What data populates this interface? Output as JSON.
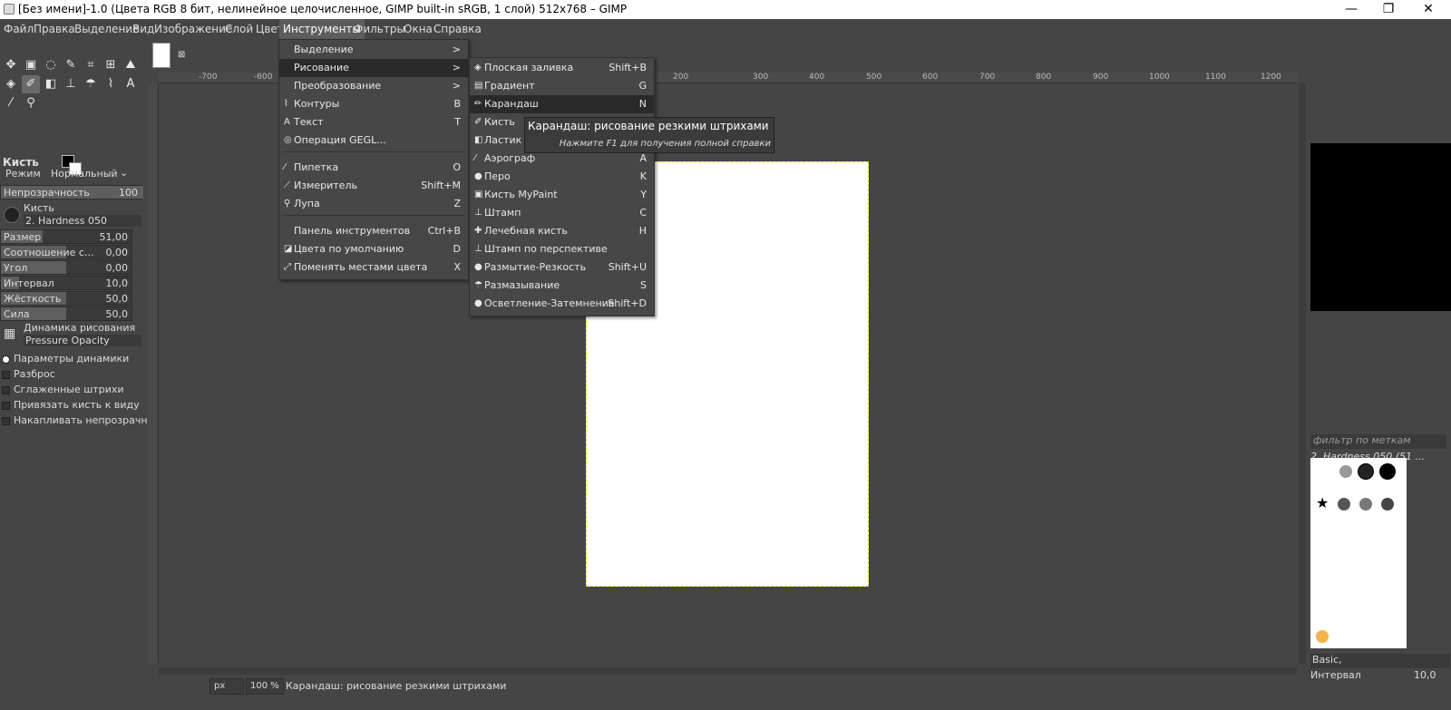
{
  "window": {
    "title": "[Без имени]-1.0 (Цвета RGB 8 бит, нелинейное целочисленное, GIMP built-in sRGB, 1 слой) 512x768 – GIMP",
    "minimize": "—",
    "maximize": "❐",
    "close": "✕"
  },
  "menubar": [
    "Файл",
    "Правка",
    "Выделение",
    "Вид",
    "Изображение",
    "Слой",
    "Цвет",
    "Инструменты",
    "Фильтры",
    "Окна",
    "Справка"
  ],
  "tools_menu": {
    "items": [
      {
        "label": "Выделение",
        "shortcut": "",
        "submenu": ">"
      },
      {
        "label": "Рисование",
        "shortcut": "",
        "submenu": ">"
      },
      {
        "label": "Преобразование",
        "shortcut": "",
        "submenu": ">"
      },
      {
        "label": "Контуры",
        "shortcut": "B"
      },
      {
        "label": "Текст",
        "shortcut": "T"
      },
      {
        "label": "Операция GEGL...",
        "shortcut": ""
      },
      {
        "label": "Пипетка",
        "shortcut": "O"
      },
      {
        "label": "Измеритель",
        "shortcut": "Shift+M"
      },
      {
        "label": "Лупа",
        "shortcut": "Z"
      },
      {
        "label": "Панель инструментов",
        "shortcut": "Ctrl+B"
      },
      {
        "label": "Цвета по умолчанию",
        "shortcut": "D"
      },
      {
        "label": "Поменять местами цвета",
        "shortcut": "X"
      }
    ]
  },
  "paint_submenu": {
    "items": [
      {
        "label": "Плоская заливка",
        "shortcut": "Shift+B"
      },
      {
        "label": "Градиент",
        "shortcut": "G"
      },
      {
        "label": "Карандаш",
        "shortcut": "N"
      },
      {
        "label": "Кисть",
        "shortcut": ""
      },
      {
        "label": "Ластик",
        "shortcut": ""
      },
      {
        "label": "Аэрограф",
        "shortcut": "A"
      },
      {
        "label": "Перо",
        "shortcut": "K"
      },
      {
        "label": "Кисть MyPaint",
        "shortcut": "Y"
      },
      {
        "label": "Штамп",
        "shortcut": "C"
      },
      {
        "label": "Лечебная кисть",
        "shortcut": "H"
      },
      {
        "label": "Штамп по перспективе",
        "shortcut": ""
      },
      {
        "label": "Размытие-Резкость",
        "shortcut": "Shift+U"
      },
      {
        "label": "Размазывание",
        "shortcut": "S"
      },
      {
        "label": "Осветление-Затемнение",
        "shortcut": "Shift+D"
      }
    ]
  },
  "tooltip": {
    "title": "Карандаш: рисование резкими штрихами",
    "hint": "Нажмите F1 для получения полной справки"
  },
  "tool_options": {
    "title": "Кисть",
    "mode_label": "Режим",
    "mode_value": "Нормальный",
    "opacity_label": "Непрозрачность",
    "opacity_value": "100",
    "brush_label": "Кисть",
    "brush_value": "2. Hardness 050",
    "sliders": [
      {
        "label": "Размер",
        "value": "51,00"
      },
      {
        "label": "Соотношение с...",
        "value": "0,00"
      },
      {
        "label": "Угол",
        "value": "0,00"
      },
      {
        "label": "Интервал",
        "value": "10,0"
      },
      {
        "label": "Жёсткость",
        "value": "50,0"
      },
      {
        "label": "Сила",
        "value": "50,0"
      }
    ],
    "dynamics_label": "Динамика рисования",
    "dynamics_value": "Pressure Opacity",
    "checks": [
      "Параметры динамики",
      "Разброс",
      "Сглаженные штрихи",
      "Привязать кисть к виду",
      "Накапливать непрозрачн"
    ]
  },
  "ruler_labels": [
    "-700",
    "-600",
    "200",
    "300",
    "400",
    "500",
    "600",
    "700",
    "800",
    "900",
    "1000",
    "1100",
    "1200"
  ],
  "statusbar": {
    "unit": "px",
    "zoom": "100 %",
    "message": "Карандаш: рисование резкими штрихами"
  },
  "right_dock": {
    "filter_placeholder": "фильтр по меткам",
    "brush_name": "2. Hardness 050 (51 ...",
    "preset": "Basic,",
    "spacing_label": "Интервал",
    "spacing_value": "10,0"
  }
}
